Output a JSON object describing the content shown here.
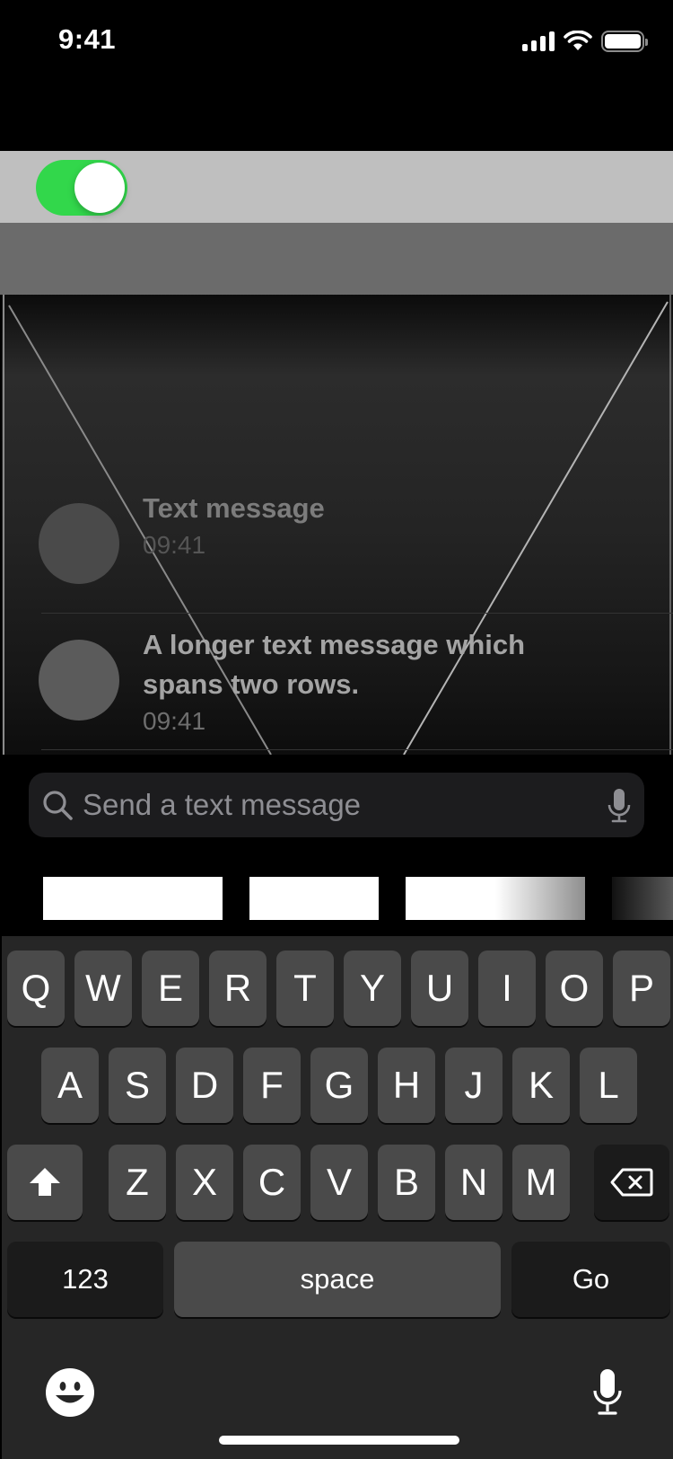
{
  "status_bar": {
    "time": "9:41",
    "icons": [
      "cellular-signal-icon",
      "wifi-icon",
      "battery-icon"
    ]
  },
  "toggle": {
    "state": "on",
    "color": "#32d74b"
  },
  "messages": [
    {
      "text": "Text message",
      "time": "09:41",
      "avatar_icon": "avatar-placeholder"
    },
    {
      "text": "A longer text message which spans two rows.",
      "time": "09:41",
      "avatar_icon": "avatar-placeholder"
    }
  ],
  "composer": {
    "placeholder": "Send a text message",
    "leading_icon": "search-icon",
    "trailing_icon": "microphone-icon"
  },
  "keyboard": {
    "row1": [
      "Q",
      "W",
      "E",
      "R",
      "T",
      "Y",
      "U",
      "I",
      "O",
      "P"
    ],
    "row2": [
      "A",
      "S",
      "D",
      "F",
      "G",
      "H",
      "J",
      "K",
      "L"
    ],
    "row3": [
      "Z",
      "X",
      "C",
      "V",
      "B",
      "N",
      "M"
    ],
    "shift_icon": "shift-arrow-icon",
    "delete_icon": "backspace-icon",
    "numbers_label": "123",
    "space_label": "space",
    "go_label": "Go",
    "emoji_icon": "emoji-icon",
    "dictation_icon": "microphone-icon"
  },
  "colors": {
    "background": "#000000",
    "toggle_on": "#32d74b",
    "key": "#4a4a4a",
    "key_dark": "#1b1b1b",
    "keyboard_bg": "#262626",
    "search_field": "#1c1c1e",
    "placeholder": "#8e8e93"
  }
}
